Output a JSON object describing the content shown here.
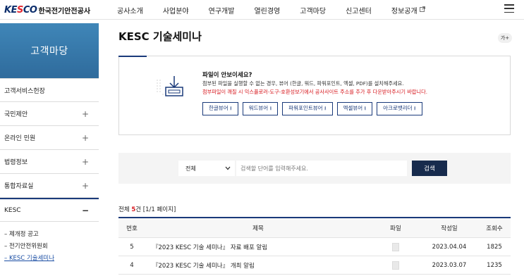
{
  "header": {
    "logo_mark_a": "KE",
    "logo_mark_b": "S",
    "logo_mark_c": "CO",
    "logo_text": "한국전기안전공사",
    "nav": [
      {
        "label": "공사소개"
      },
      {
        "label": "사업분야"
      },
      {
        "label": "연구개발"
      },
      {
        "label": "열린경영"
      },
      {
        "label": "고객마당"
      },
      {
        "label": "신고센터"
      },
      {
        "label": "정보공개"
      }
    ],
    "external_icon": "external-link-icon",
    "menu_icon": "hamburger-menu-icon"
  },
  "sidebar": {
    "title": "고객마당",
    "items": [
      {
        "label": "고객서비스헌장",
        "sign": ""
      },
      {
        "label": "국민제안",
        "sign": "+"
      },
      {
        "label": "온라인 민원",
        "sign": "+"
      },
      {
        "label": "법령정보",
        "sign": "+"
      },
      {
        "label": "통합자료실",
        "sign": "+"
      },
      {
        "label": "KESC",
        "sign": "−"
      }
    ],
    "sub_items": [
      {
        "label": "– 제개정 공고"
      },
      {
        "label": "– 전기안전위원회"
      },
      {
        "label": "– KESC 기술세미나"
      }
    ]
  },
  "main": {
    "title": "KESC 기술세미나",
    "font_button": "가+",
    "notice": {
      "title": "파일이 안보이세요?",
      "desc": "첨부된 파일을 실행할 수 없는 경우, 뷰어 (한글, 워드, 파워포인트, 엑셀, PDF)를 설치해주세요.",
      "warning": "첨부파일이 깨질 시 익스플로러-도구-호환성보기에서 공사사이트 주소를 추가 후 다운받아주시기 바랍니다.",
      "viewers": [
        {
          "label": "한글뷰어 ⭳"
        },
        {
          "label": "워드뷰어 ⭳"
        },
        {
          "label": "파워포인트뷰어 ⭳"
        },
        {
          "label": "엑셀뷰어 ⭳"
        },
        {
          "label": "아크로뱃리더 ⭳"
        }
      ]
    },
    "search": {
      "select_value": "전체",
      "placeholder": "검색할 단어를 입력해주세요.",
      "button": "검색"
    },
    "total": {
      "prefix": "전체 ",
      "count": "5",
      "suffix": "건 [1/1 페이지]"
    },
    "table": {
      "headers": {
        "no": "번호",
        "title": "제목",
        "file": "파일",
        "date": "작성일",
        "views": "조회수"
      },
      "rows": [
        {
          "no": "5",
          "title": "『2023 KESC 기술 세미나』 자료 배포 알림",
          "date": "2023.04.04",
          "views": "1825"
        },
        {
          "no": "4",
          "title": "『2023 KESC 기술 세미나』 개최 알림",
          "date": "2023.03.07",
          "views": "1235"
        }
      ]
    }
  }
}
